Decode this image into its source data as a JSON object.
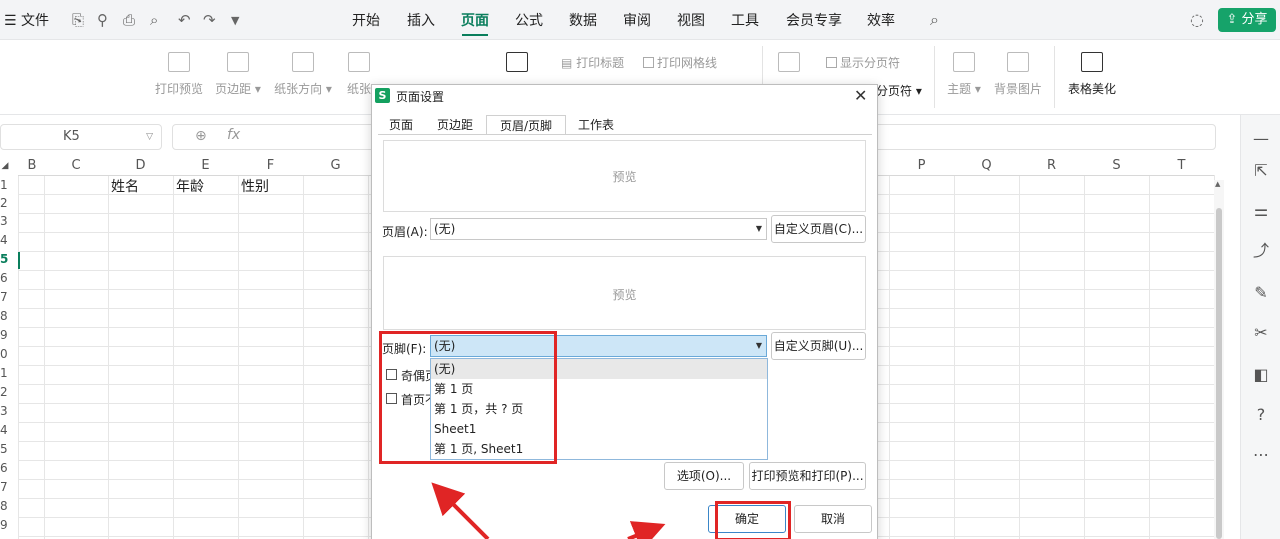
{
  "menu": {
    "file_label": "文件",
    "tabs": [
      "开始",
      "插入",
      "页面",
      "公式",
      "数据",
      "审阅",
      "视图",
      "工具",
      "会员专享",
      "效率"
    ],
    "active_tab": "页面",
    "share_label": "分享"
  },
  "ribbon": {
    "print_preview": "打印预览",
    "margins": "页边距",
    "orientation": "纸张方向",
    "paper_size": "纸张",
    "print_titles": "打印标题",
    "print_gridlines": "打印网格线",
    "show_page_breaks": "显示分页符",
    "page_break": "分页符",
    "theme": "主题",
    "background": "背景图片",
    "table_beautify": "表格美化"
  },
  "formula_bar": {
    "cell_ref": "K5",
    "fx_label": "fx"
  },
  "grid": {
    "columns": [
      "B",
      "C",
      "D",
      "E",
      "F",
      "G",
      "P",
      "Q",
      "R",
      "S",
      "T"
    ],
    "rows": [
      "1",
      "2",
      "3",
      "4",
      "5",
      "6",
      "7",
      "8",
      "9",
      "0",
      "1",
      "2",
      "3",
      "4",
      "5",
      "6",
      "7",
      "8",
      "9"
    ],
    "headers": [
      "姓名",
      "年龄",
      "性别"
    ]
  },
  "dialog": {
    "title": "页面设置",
    "logo": "S",
    "tabs": [
      "页面",
      "页边距",
      "页眉/页脚",
      "工作表"
    ],
    "active_tab": "页眉/页脚",
    "preview_label": "预览",
    "header_label": "页眉(A):",
    "header_value": "(无)",
    "custom_header": "自定义页眉(C)...",
    "footer_label": "页脚(F):",
    "footer_value": "(无)",
    "custom_footer": "自定义页脚(U)...",
    "footer_options": [
      "(无)",
      "第 1 页",
      "第 1 页，共 ? 页",
      "Sheet1",
      "第 1 页, Sheet1"
    ],
    "odd_even_label": "奇偶页",
    "first_page_label": "首页不",
    "options_button": "选项(O)...",
    "print_preview_button": "打印预览和打印(P)...",
    "ok_button": "确定",
    "cancel_button": "取消"
  },
  "colors": {
    "accent": "#0a7e5c",
    "share_green": "#16a36a",
    "annotation_red": "#e02525"
  }
}
